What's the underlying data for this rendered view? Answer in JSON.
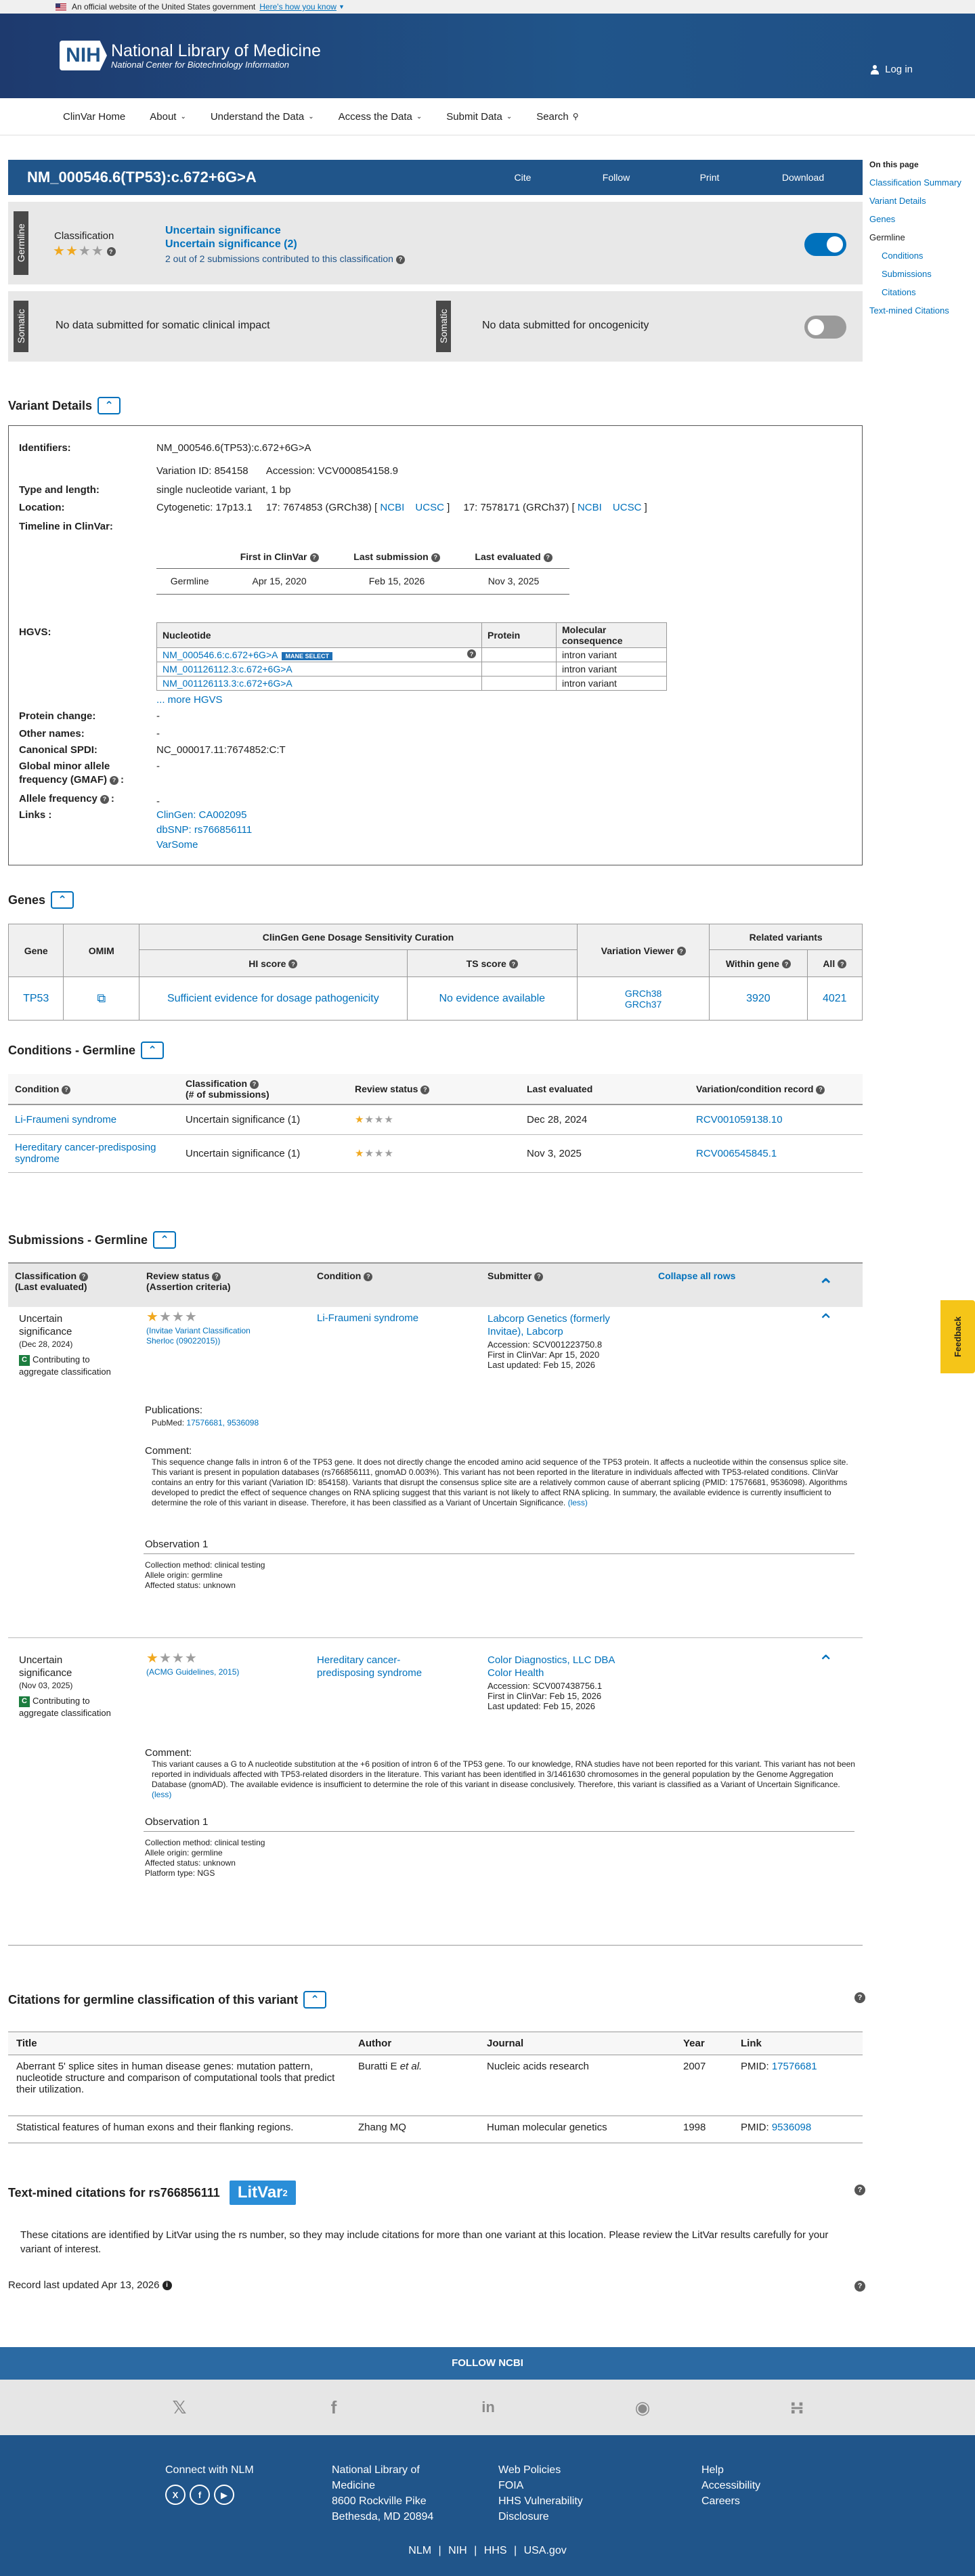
{
  "gov_banner": {
    "text": "An official website of the United States government",
    "link": "Here's how you know"
  },
  "header": {
    "logo": "NIH",
    "name": "National Library of Medicine",
    "sub": "National Center for Biotechnology Information",
    "login": "Log in"
  },
  "nav": [
    "ClinVar Home",
    "About",
    "Understand the Data",
    "Access the Data",
    "Submit Data",
    "Search"
  ],
  "title": "NM_000546.6(TP53):c.672+6G>A",
  "title_actions": [
    "Cite",
    "Follow",
    "Print",
    "Download"
  ],
  "sidebar": {
    "heading": "On this page",
    "items": [
      "Classification Summary",
      "Variant Details",
      "Genes",
      "Germline",
      "Conditions",
      "Submissions",
      "Citations",
      "Text-mined Citations"
    ]
  },
  "germline": {
    "tag": "Germline",
    "label": "Classification",
    "line1": "Uncertain significance",
    "line2": "Uncertain significance (2)",
    "line3": "2 out of 2 submissions contributed to this classification"
  },
  "somatic": {
    "tag1": "Somatic",
    "text1": "No data submitted for somatic clinical impact",
    "tag2": "Somatic",
    "text2": "No data submitted for oncogenicity"
  },
  "variant_details": {
    "heading": "Variant Details",
    "identifiers_label": "Identifiers:",
    "identifiers": "NM_000546.6(TP53):c.672+6G>A",
    "variation_id": "Variation ID: 854158",
    "accession": "Accession: VCV000854158.9",
    "type_label": "Type and length:",
    "type": "single nucleotide variant, 1 bp",
    "location_label": "Location:",
    "cytogenetic": "Cytogenetic: 17p13.1",
    "loc38": "17: 7674853 (GRCh38) [",
    "loc37": "17: 7578171 (GRCh37) [",
    "ncbi": "NCBI",
    "ucsc": "UCSC",
    "bracket_close": "]",
    "timeline_label": "Timeline in ClinVar:",
    "timeline_headers": [
      "First in ClinVar",
      "Last submission",
      "Last evaluated"
    ],
    "timeline_row": [
      "Germline",
      "Apr 15, 2020",
      "Feb 15, 2026",
      "Nov 3, 2025"
    ],
    "hgvs_label": "HGVS:",
    "hgvs_headers": [
      "Nucleotide",
      "Protein",
      "Molecular consequence"
    ],
    "hgvs_rows": [
      {
        "nuc": "NM_000546.6:c.672+6G>A",
        "mane": "MANE SELECT",
        "prot": "",
        "cons": "intron variant"
      },
      {
        "nuc": "NM_001126112.3:c.672+6G>A",
        "prot": "",
        "cons": "intron variant"
      },
      {
        "nuc": "NM_001126113.3:c.672+6G>A",
        "prot": "",
        "cons": "intron variant"
      }
    ],
    "more_hgvs": "... more HGVS",
    "protein_change_label": "Protein change:",
    "protein_change": "-",
    "other_names_label": "Other names:",
    "other_names": "-",
    "spdi_label": "Canonical SPDI:",
    "spdi": "NC_000017.11:7674852:C:T",
    "gmaf_label1": "Global minor allele",
    "gmaf_label2": "frequency (GMAF)",
    "gmaf_colon": ":",
    "gmaf": "-",
    "allele_freq_label": "Allele frequency",
    "allele_freq_colon": ":",
    "allele_freq": "-",
    "links_label": "Links :",
    "links": [
      "ClinGen: CA002095",
      "dbSNP: rs766856111",
      "VarSome"
    ]
  },
  "genes": {
    "heading": "Genes",
    "headers": {
      "gene": "Gene",
      "omim": "OMIM",
      "curation": "ClinGen Gene Dosage Sensitivity Curation",
      "hi": "HI score",
      "ts": "TS score",
      "viewer": "Variation Viewer",
      "related": "Related variants",
      "within": "Within gene",
      "all": "All"
    },
    "row": {
      "gene": "TP53",
      "hi": "Sufficient evidence for dosage pathogenicity",
      "ts": "No evidence available",
      "v38": "GRCh38",
      "v37": "GRCh37",
      "within": "3920",
      "all": "4021"
    }
  },
  "conditions": {
    "heading": "Conditions - Germline",
    "headers": [
      "Condition",
      "Classification",
      "(# of submissions)",
      "Review status",
      "Last evaluated",
      "Variation/condition record"
    ],
    "rows": [
      {
        "condition": "Li-Fraumeni syndrome",
        "classification": "Uncertain significance (1)",
        "last": "Dec 28, 2024",
        "record": "RCV001059138.10"
      },
      {
        "condition": "Hereditary cancer-predisposing syndrome",
        "classification": "Uncertain significance (1)",
        "last": "Nov 3, 2025",
        "record": "RCV006545845.1"
      }
    ]
  },
  "submissions": {
    "heading": "Submissions - Germline",
    "headers": {
      "classification": "Classification",
      "last_eval": "(Last evaluated)",
      "review": "Review status",
      "criteria": "(Assertion criteria)",
      "condition": "Condition",
      "submitter": "Submitter",
      "collapse": "Collapse all rows"
    },
    "s1": {
      "class1": "Uncertain",
      "class2": "significance",
      "date": "(Dec 28, 2024)",
      "contrib1": "Contributing to",
      "contrib2": "aggregate classification",
      "criteria1": "(Invitae Variant Classification",
      "criteria2": "Sherloc (09022015))",
      "condition": "Li-Fraumeni syndrome",
      "submitter1": "Labcorp Genetics (formerly",
      "submitter2": "Invitae), Labcorp",
      "acc": "Accession: SCV001223750.8",
      "first": "First in ClinVar: Apr 15, 2020",
      "updated": "Last updated: Feb 15, 2026",
      "pub_label": "Publications:",
      "pubmed_label": "PubMed:",
      "pubmed": "17576681, 9536098",
      "comment_label": "Comment:",
      "comment": "This sequence change falls in intron 6 of the TP53 gene. It does not directly change the encoded amino acid sequence of the TP53 protein. It affects a nucleotide within the consensus splice site. This variant is present in population databases (rs766856111, gnomAD 0.003%). This variant has not been reported in the literature in individuals affected with TP53-related conditions. ClinVar contains an entry for this variant (Variation ID: 854158). Variants that disrupt the consensus splice site are a relatively common cause of aberrant splicing (PMID: 17576681, 9536098). Algorithms developed to predict the effect of sequence changes on RNA splicing suggest that this variant is not likely to affect RNA splicing. In summary, the available evidence is currently insufficient to determine the role of this variant in disease. Therefore, it has been classified as a Variant of Uncertain Significance.",
      "less": "(less)",
      "obs": "Observation 1",
      "method": "Collection method: clinical testing",
      "origin": "Allele origin: germline",
      "affected": "Affected status: unknown"
    },
    "s2": {
      "class1": "Uncertain",
      "class2": "significance",
      "date": "(Nov 03, 2025)",
      "contrib1": "Contributing to",
      "contrib2": "aggregate classification",
      "criteria1": "(ACMG Guidelines, 2015)",
      "condition1": "Hereditary cancer-",
      "condition2": "predisposing syndrome",
      "submitter1": "Color Diagnostics, LLC DBA",
      "submitter2": "Color Health",
      "acc": "Accession: SCV007438756.1",
      "first": "First in ClinVar: Feb 15, 2026",
      "updated": "Last updated: Feb 15, 2026",
      "comment_label": "Comment:",
      "comment": "This variant causes a G to A nucleotide substitution at the +6 position of intron 6 of the TP53 gene. To our knowledge, RNA studies have not been reported for this variant. This variant has not been reported in individuals affected with TP53-related disorders in the literature. This variant has been identified in 3/1461630 chromosomes in the general population by the Genome Aggregation Database (gnomAD). The available evidence is insufficient to determine the role of this variant in disease conclusively. Therefore, this variant is classified as a Variant of Uncertain Significance.",
      "less": "(less)",
      "obs": "Observation 1",
      "method": "Collection method: clinical testing",
      "origin": "Allele origin: germline",
      "affected": "Affected status: unknown",
      "platform": "Platform type: NGS"
    }
  },
  "citations": {
    "heading": "Citations for germline classification of this variant",
    "headers": [
      "Title",
      "Author",
      "Journal",
      "Year",
      "Link"
    ],
    "rows": [
      {
        "title": "Aberrant 5' splice sites in human disease genes: mutation pattern, nucleotide structure and comparison of computational tools that predict their utilization.",
        "author": "Buratti E",
        "etal": "et al.",
        "journal": "Nucleic acids research",
        "year": "2007",
        "pmid_label": "PMID:",
        "pmid": "17576681"
      },
      {
        "title": "Statistical features of human exons and their flanking regions.",
        "author": "Zhang MQ",
        "journal": "Human molecular genetics",
        "year": "1998",
        "pmid_label": "PMID:",
        "pmid": "9536098"
      }
    ]
  },
  "textmined": {
    "heading": "Text-mined citations for rs766856111",
    "litvar": "LitVar",
    "litvar_sup": "2",
    "text": "These citations are identified by LitVar using the rs number, so they may include citations for more than one variant at this location. Please review the LitVar results carefully for your variant of interest."
  },
  "record_updated": "Record last updated Apr 13, 2026",
  "feedback": "Feedback",
  "footer": {
    "follow": "FOLLOW NCBI",
    "connect": "Connect with NLM",
    "addr": [
      "National Library of",
      "Medicine",
      "8600 Rockville Pike",
      "Bethesda, MD 20894"
    ],
    "col3": [
      "Web Policies",
      "FOIA",
      "HHS Vulnerability",
      "Disclosure"
    ],
    "col4": [
      "Help",
      "Accessibility",
      "Careers"
    ],
    "bottom": [
      "NLM",
      "|",
      "NIH",
      "|",
      "HHS",
      "|",
      "USA.gov"
    ]
  },
  "colors": {
    "brand": "#20558a",
    "link": "#0071bc",
    "star": "#f0a81f",
    "contributing": "#1c7d3f"
  }
}
